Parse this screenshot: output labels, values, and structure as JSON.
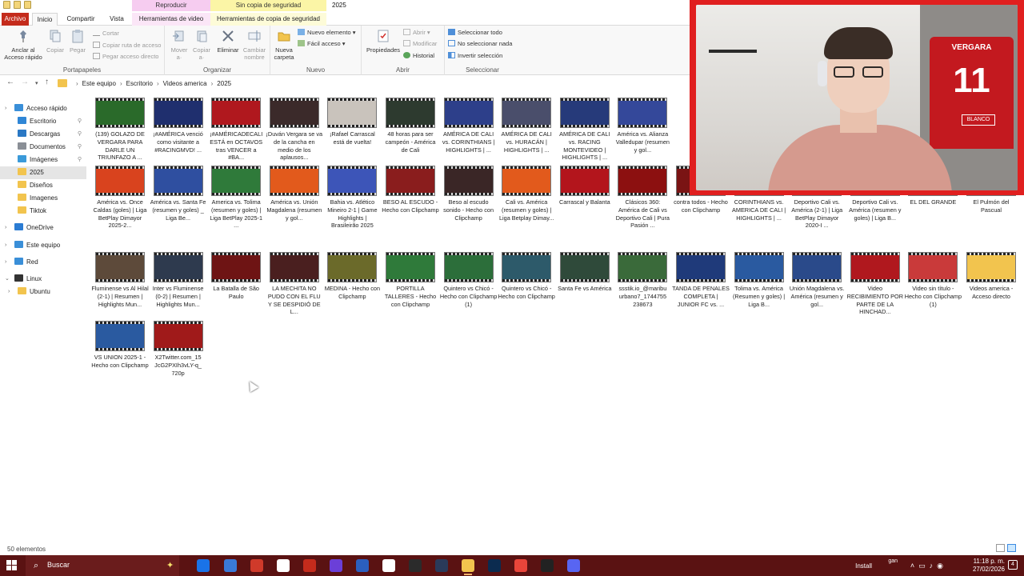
{
  "window": {
    "ctx_tab_reproducir": "Reproducir",
    "ctx_tab_sin_copia": "Sin copia de seguridad",
    "title": "2025"
  },
  "tabs": [
    "Archivo",
    "Inicio",
    "Compartir",
    "Vista",
    "Herramientas de video",
    "Herramientas de copia de seguridad"
  ],
  "ribbon": {
    "portapapeles": {
      "label": "Portapapeles",
      "anclar": "Anclar al Acceso rápido",
      "copiar": "Copiar",
      "pegar": "Pegar",
      "cortar": "Cortar",
      "copiar_ruta": "Copiar ruta de acceso",
      "pegar_acceso": "Pegar acceso directo"
    },
    "organizar": {
      "label": "Organizar",
      "mover": "Mover a·",
      "copiar_a": "Copiar a·",
      "eliminar": "Eliminar",
      "cambiar": "Cambiar nombre"
    },
    "nuevo": {
      "label": "Nuevo",
      "nueva_carpeta": "Nueva carpeta",
      "nuevo_elemento": "Nuevo elemento ▾",
      "facil_acceso": "Fácil acceso ▾"
    },
    "abrir": {
      "label": "Abrir",
      "propiedades": "Propiedades",
      "abrir": "Abrir ▾",
      "modificar": "Modificar",
      "historial": "Historial"
    },
    "seleccionar": {
      "label": "Seleccionar",
      "todo": "Seleccionar todo",
      "nada": "No seleccionar nada",
      "invertir": "Invertir selección"
    }
  },
  "breadcrumbs": [
    "Este equipo",
    "Escritorio",
    "Videos america",
    "2025"
  ],
  "nav": {
    "items": [
      {
        "label": "Acceso rápido",
        "icon": "star-icon",
        "color": "#3a8fd8",
        "pinned": false
      },
      {
        "label": "Escritorio",
        "icon": "desktop-icon",
        "color": "#2f86d6",
        "pinned": true
      },
      {
        "label": "Descargas",
        "icon": "download-icon",
        "color": "#2a78c4",
        "pinned": true
      },
      {
        "label": "Documentos",
        "icon": "documents-icon",
        "color": "#8a8f96",
        "pinned": true
      },
      {
        "label": "Imágenes",
        "icon": "pictures-icon",
        "color": "#3a9ad9",
        "pinned": true
      },
      {
        "label": "2025",
        "icon": "folder-icon",
        "color": "#f2c44e",
        "pinned": false
      },
      {
        "label": "Diseños",
        "icon": "folder-icon",
        "color": "#f2c44e",
        "pinned": false
      },
      {
        "label": "Imagenes",
        "icon": "folder-icon",
        "color": "#f2c44e",
        "pinned": false
      },
      {
        "label": "Tiktok",
        "icon": "folder-icon",
        "color": "#f2c44e",
        "pinned": false
      },
      {
        "label": "OneDrive",
        "icon": "cloud-icon",
        "color": "#2b7cd3",
        "pinned": false
      },
      {
        "label": "Este equipo",
        "icon": "pc-icon",
        "color": "#3a8fd8",
        "pinned": false
      },
      {
        "label": "Red",
        "icon": "network-icon",
        "color": "#3a8fd8",
        "pinned": false
      },
      {
        "label": "Linux",
        "icon": "linux-icon",
        "color": "#333333",
        "pinned": false
      },
      {
        "label": "Ubuntu",
        "icon": "folder-icon",
        "color": "#f2c44e",
        "pinned": false
      }
    ]
  },
  "files": [
    {
      "name": "(139) GOLAZO DE VERGARA PARA DARLE UN TRIUNFAZO A ...",
      "color": "#2a6a2a"
    },
    {
      "name": "¡#AMÉRICA venció como visitante a #RACINGMVD! ...",
      "color": "#1f2f6e"
    },
    {
      "name": "¡#AMÉRICADECALI ESTÁ en OCTAVOS tras VENCER a #BA...",
      "color": "#b0181e"
    },
    {
      "name": "¡Duván Vergara se va de la cancha en medio de los aplausos...",
      "color": "#3b2a2a"
    },
    {
      "name": "¡Rafael Carrascal está de vuelta!",
      "color": "#c9c3bc"
    },
    {
      "name": "48 horas para ser campeón - América de Cali",
      "color": "#2d3a2f"
    },
    {
      "name": "AMÉRICA DE CALI vs. CORINTHIANS | HIGHLIGHTS | ...",
      "color": "#2d3f8a"
    },
    {
      "name": "AMÉRICA DE CALI vs. HURACÁN | HIGHLIGHTS | ...",
      "color": "#4a4e6b"
    },
    {
      "name": "AMÉRICA DE CALI vs. RACING MONTEVIDEO | HIGHLIGHTS | ...",
      "color": "#263a7a"
    },
    {
      "name": "América vs. Alianza Valledupar (resumen y gol...",
      "color": "#34489a"
    },
    {
      "name": "América vs. Once Caldas (goles) | Liga BetPlay Dimayor 2025-2...",
      "color": "#d9431e"
    },
    {
      "name": "América vs. Santa Fe (resumen y goles) _ Liga Be...",
      "color": "#2f4fa0"
    },
    {
      "name": "America vs. Tolima (resumen y goles) | Liga BetPlay 2025-1 ...",
      "color": "#2f7a3a"
    },
    {
      "name": "América vs. Unión Magdalena (resumen y gol...",
      "color": "#e25a1c"
    },
    {
      "name": "Bahia vs. Atlético Mineiro 2-1 | Game Highlights | Brasileirão 2025",
      "color": "#3d55b8"
    },
    {
      "name": "BESO AL ESCUDO - Hecho con Clipchamp",
      "color": "#8a1d1d"
    },
    {
      "name": "Beso al escudo sonido - Hecho con Clipchamp",
      "color": "#3a2626"
    },
    {
      "name": "Cali vs. América (resumen y goles) | Liga Betplay Dimay...",
      "color": "#e25a1c"
    },
    {
      "name": "Carrascal y Balanta",
      "color": "#b3151c"
    },
    {
      "name": "Clásicos 360: América de Cali vs Deportivo Cali | Pura Pasión ...",
      "color": "#8c1010"
    },
    {
      "name": "contra todos - Hecho con Clipchamp",
      "color": "#7a1414"
    },
    {
      "name": "CORINTHIANS vs. AMERICA DE CALI | HIGHLIGHTS | ...",
      "color": "#2a2a5a"
    },
    {
      "name": "Deportivo Cali vs. América (2-1) | Liga BetPlay Dimayor 2020-I ...",
      "color": "#2d6a2d"
    },
    {
      "name": "Deportivo Cali vs. América (resumen y goles) | Liga B...",
      "color": "#2e5c2e"
    },
    {
      "name": "EL DEL GRANDE",
      "color": "#a01717"
    },
    {
      "name": "El Pulmón del Pascual",
      "color": "#9e1a1a"
    },
    {
      "name": "Fluminense vs Al Hilal (2-1) | Resumen | Highlights Mun...",
      "color": "#5d4a3a"
    },
    {
      "name": "Inter vs Fluminense (0-2) | Resumen | Highlights Mun...",
      "color": "#2e3a4e"
    },
    {
      "name": "La Batalla de São Paulo",
      "color": "#6e1414"
    },
    {
      "name": "LA MECHITA NO PUDO CON EL FLU Y SE DESPIDIÓ DE L...",
      "color": "#4a1f1f"
    },
    {
      "name": "MEDINA - Hecho con Clipchamp",
      "color": "#6b6a2a"
    },
    {
      "name": "PORTILLA TALLERES - Hecho con Clipchamp",
      "color": "#2f7a3a"
    },
    {
      "name": "Quintero vs Chicó - Hecho con Clipchamp (1)",
      "color": "#2c6e3a"
    },
    {
      "name": "Quintero vs Chicó - Hecho con Clipchamp",
      "color": "#2d5a6a"
    },
    {
      "name": "Santa Fe vs América",
      "color": "#2f4a3a"
    },
    {
      "name": "ssstik.io_@maribu urbano7_1744755 238673",
      "color": "#3a6a3a"
    },
    {
      "name": "TANDA DE PENALES COMPLETA | JUNIOR FC vs. ...",
      "color": "#1f3a7a"
    },
    {
      "name": "Tolima vs. América (Resumen y goles) | Liga B...",
      "color": "#2a5aa0"
    },
    {
      "name": "Unión Magdalena vs. América (resumen y gol...",
      "color": "#2a4a8a"
    },
    {
      "name": "Video RECIBIMIENTO POR PARTE DE LA HINCHAD...",
      "color": "#b0181e"
    },
    {
      "name": "Video sin título - Hecho con Clipchamp (1)",
      "color": "#c93a3a"
    },
    {
      "name": "Videos america - Acceso directo",
      "color": "#f2c44e"
    },
    {
      "name": "VS UNION 2025-1 - Hecho con Clipchamp",
      "color": "#2a5aa0"
    },
    {
      "name": "X2Twitter.com_15 JcG2PXIh3vLY-q_ 720p",
      "color": "#a01a1a"
    }
  ],
  "status": {
    "count": "50 elementos"
  },
  "cam": {
    "jersey_name": "VERGARA",
    "jersey_number": "11",
    "jersey_badge": "BLANCO"
  },
  "taskbar": {
    "search_placeholder": "Buscar",
    "install": "Install",
    "weather": "gan",
    "time": "11:18 p. m.",
    "date": "27/02/2026",
    "notif_count": "4"
  },
  "colors": {
    "accent": "#c42b1c",
    "taskbar": "#5a1212",
    "cam_frame": "#e01f1f"
  }
}
